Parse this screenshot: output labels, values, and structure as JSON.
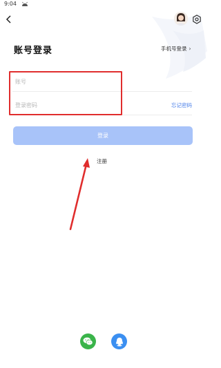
{
  "status_bar": {
    "time": "9:04"
  },
  "header": {
    "title": "账号登录",
    "phone_login_label": "手机号登录",
    "phone_login_chevron": "›"
  },
  "form": {
    "account_placeholder": "账号",
    "password_placeholder": "登录密码",
    "forgot_password_label": "忘记密码"
  },
  "login_button_label": "登录",
  "register_label": "注册",
  "icons": {
    "back": "back-arrow-icon",
    "avatar": "user-avatar",
    "settings": "gear-icon",
    "wechat": "wechat-icon",
    "qq": "qq-icon"
  },
  "colors": {
    "accent_link": "#4a7fe8",
    "login_button_disabled": "#a8c3f9",
    "wechat_green": "#3ab44a",
    "qq_blue": "#3b8ff1",
    "annotation_red": "#e02d2d"
  }
}
